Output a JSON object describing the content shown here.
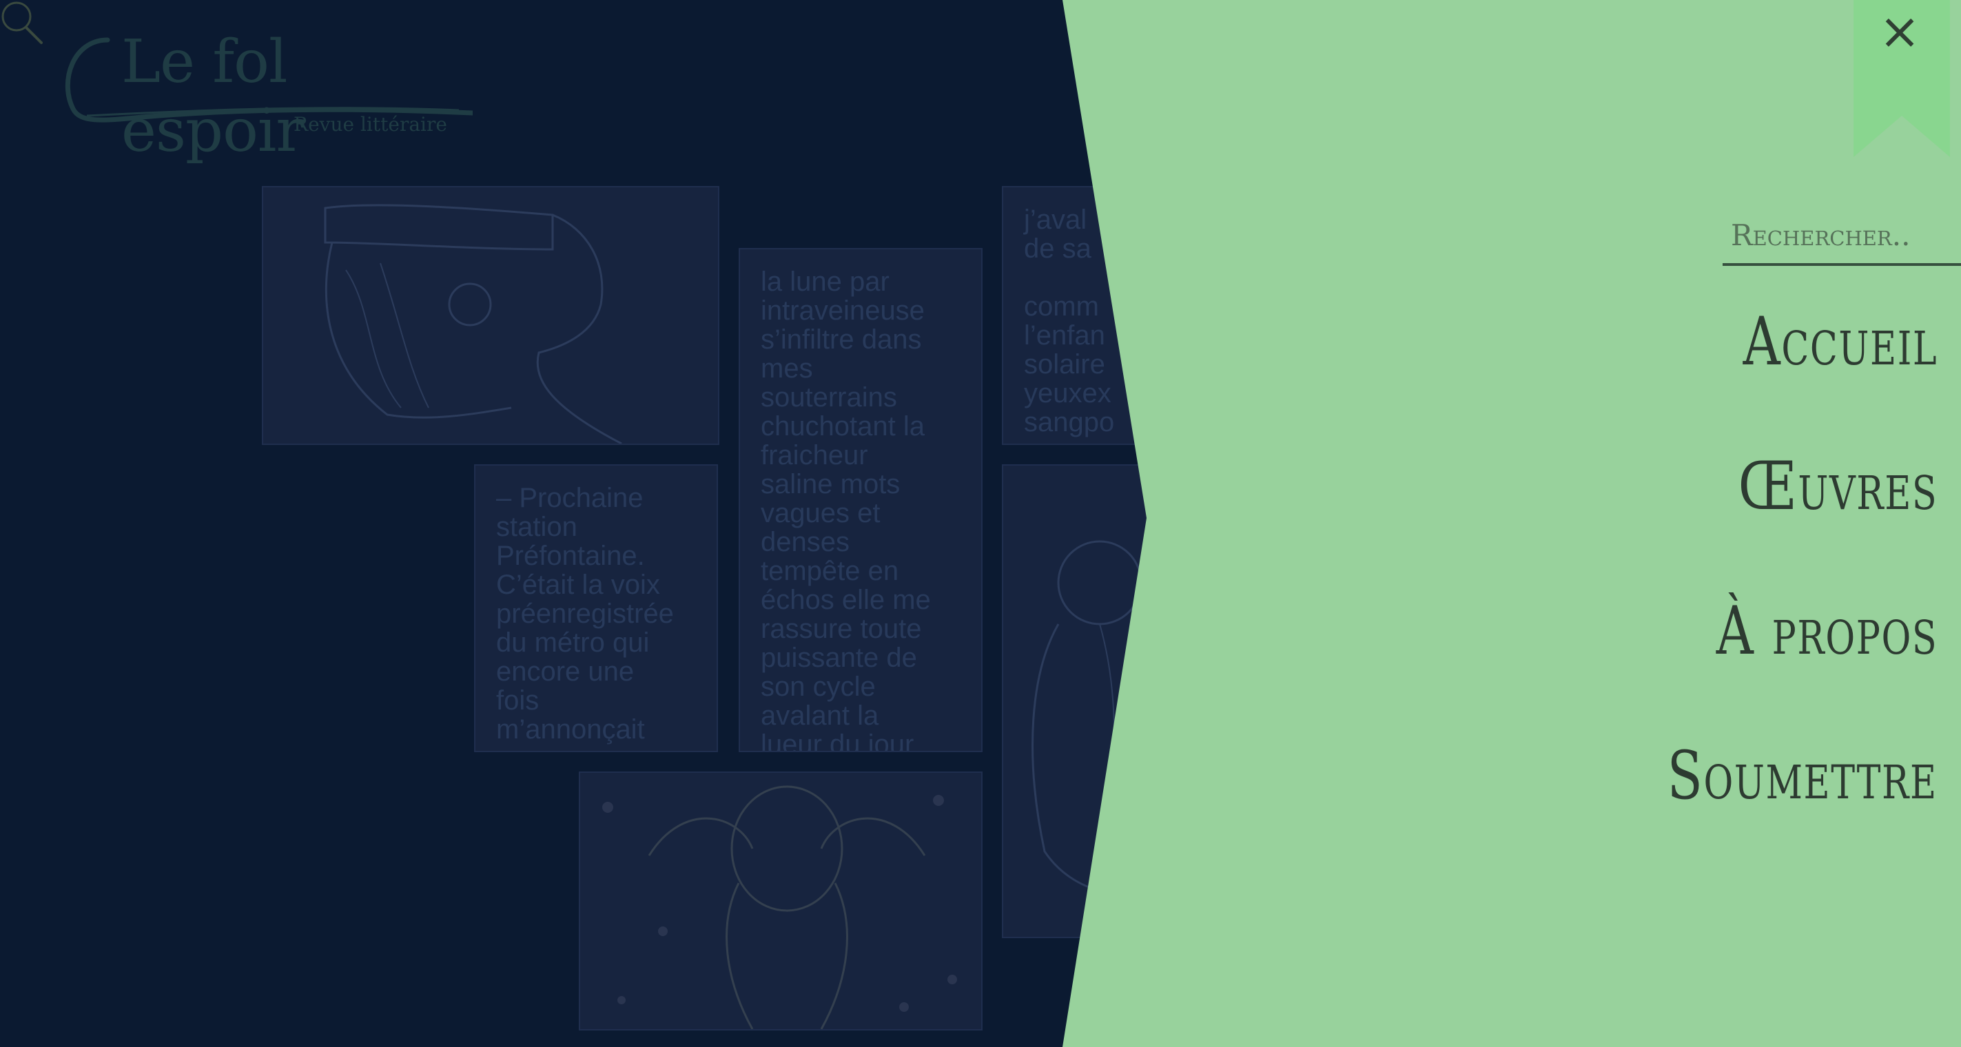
{
  "logo": {
    "title": "Le fol espoir",
    "subtitle": "Revue littéraire"
  },
  "cards": {
    "text1": "la lune par\nintraveineuse\ns’infiltre dans\nmes\nsouterrains\nchuchotant la\nfraicheur\nsaline mots\nvagues et\ndenses\ntempête en\néchos elle me\nrassure toute\npuissante de\nson cycle\navalant la\nlueur du jour",
    "text2": "– Prochaine\nstation\nPréfontaine.\nC’était la voix\npréenregistrée\ndu métro qui\nencore une\nfois\nm’annonçait",
    "text3": "j’aval\nde sa\n\ncomm\nl’enfan\nsolaire\nyeuxex\nsangpo"
  },
  "menu": {
    "close_label": "×",
    "search_placeholder": "Rechercher..",
    "items": [
      "Accueil",
      "Œuvres",
      "À propos",
      "Soumettre"
    ]
  },
  "icons": {
    "close": "close-icon",
    "search": "search-icon"
  },
  "colors": {
    "overlay": "#98d29c",
    "background": "#061c2a",
    "bookmark": "#89d68f",
    "menu_text": "#2d3b31"
  }
}
